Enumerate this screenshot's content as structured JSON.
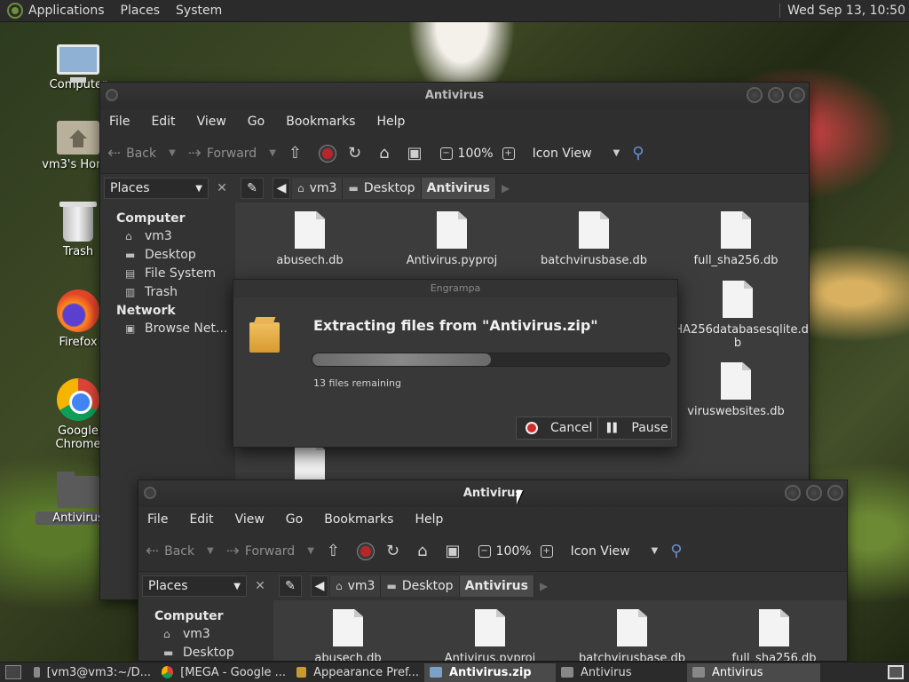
{
  "top_panel": {
    "menus": [
      "Applications",
      "Places",
      "System"
    ],
    "clock": "Wed Sep 13, 10:50"
  },
  "desktop_icons": [
    {
      "label": "Computer",
      "icon": "computer-icon"
    },
    {
      "label": "vm3's Home",
      "icon": "home-folder-icon"
    },
    {
      "label": "Trash",
      "icon": "trash-icon"
    },
    {
      "label": "Firefox",
      "icon": "firefox-icon"
    },
    {
      "label": "Google Chrome",
      "icon": "chrome-icon"
    },
    {
      "label": "Antivirus",
      "icon": "folder-icon"
    }
  ],
  "window_back": {
    "title": "Antivirus",
    "menu": [
      "File",
      "Edit",
      "View",
      "Go",
      "Bookmarks",
      "Help"
    ],
    "toolbar": {
      "back": "Back",
      "forward": "Forward",
      "zoom": "100%",
      "view_mode": "Icon View"
    },
    "places_label": "Places",
    "breadcrumbs": [
      "vm3",
      "Desktop",
      "Antivirus"
    ],
    "sidebar": {
      "computer_header": "Computer",
      "computer_items": [
        "vm3",
        "Desktop",
        "File System",
        "Trash"
      ],
      "network_header": "Network",
      "network_items": [
        "Browse Net..."
      ]
    },
    "files": [
      "abusech.db",
      "Antivirus.pyproj",
      "batchvirusbase.db",
      "full_sha256.db",
      "SHA256databasesqlite.db",
      "viruswebsites.db"
    ]
  },
  "dialog": {
    "app_title": "Engrampa",
    "heading": "Extracting files from \"Antivirus.zip\"",
    "progress": 0.5,
    "remaining": "13 files remaining",
    "cancel": "Cancel",
    "pause": "Pause"
  },
  "window_front": {
    "title": "Antivirus",
    "menu": [
      "File",
      "Edit",
      "View",
      "Go",
      "Bookmarks",
      "Help"
    ],
    "toolbar": {
      "back": "Back",
      "forward": "Forward",
      "zoom": "100%",
      "view_mode": "Icon View"
    },
    "places_label": "Places",
    "breadcrumbs": [
      "vm3",
      "Desktop",
      "Antivirus"
    ],
    "sidebar": {
      "computer_header": "Computer",
      "computer_items": [
        "vm3",
        "Desktop"
      ]
    },
    "files": [
      "abusech.db",
      "Antivirus.pyproj",
      "batchvirusbase.db",
      "full_sha256.db"
    ]
  },
  "taskbar": [
    {
      "label": "[vm3@vm3:~/D...",
      "icon": "terminal-icon",
      "active": false
    },
    {
      "label": "[MEGA - Google ...",
      "icon": "chrome-icon",
      "active": false
    },
    {
      "label": "Appearance Pref...",
      "icon": "appearance-icon",
      "active": false
    },
    {
      "label": "Antivirus.zip",
      "icon": "archive-icon",
      "active": true
    },
    {
      "label": "Antivirus",
      "icon": "folder-icon",
      "active": false
    },
    {
      "label": "Antivirus",
      "icon": "folder-icon",
      "active": false
    }
  ]
}
